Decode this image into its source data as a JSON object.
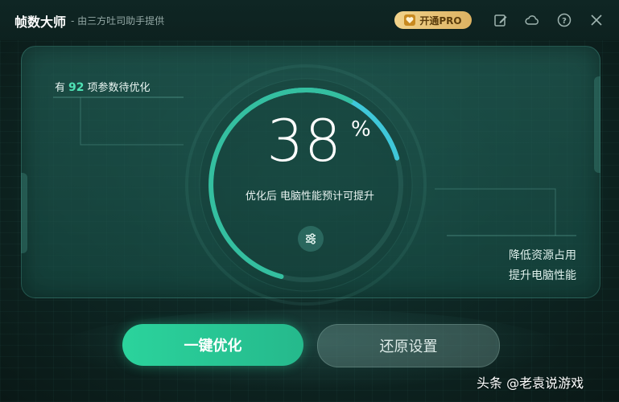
{
  "app": {
    "title": "帧数大师",
    "subtitle": "- 由三方吐司助手提供",
    "pro_button": "开通PRO"
  },
  "titlebar_icons": [
    "edit-icon",
    "cloud-icon",
    "help-icon",
    "close-icon"
  ],
  "status": {
    "pending_prefix": "有",
    "pending_count": "92",
    "pending_suffix": "项参数待优化"
  },
  "gauge": {
    "value": "38",
    "unit": "%",
    "caption": "优化后 电脑性能预计可提升",
    "progress_fraction": 0.38
  },
  "benefits": [
    "降低资源占用",
    "提升电脑性能"
  ],
  "actions": {
    "optimize": "一键优化",
    "restore": "还原设置"
  },
  "watermark": "头条 @老袁说游戏",
  "colors": {
    "accent": "#2bd39c",
    "pro_gold": "#e8c476",
    "ring_cyan": "#3fc7d9",
    "count_green": "#4fe2b5"
  }
}
